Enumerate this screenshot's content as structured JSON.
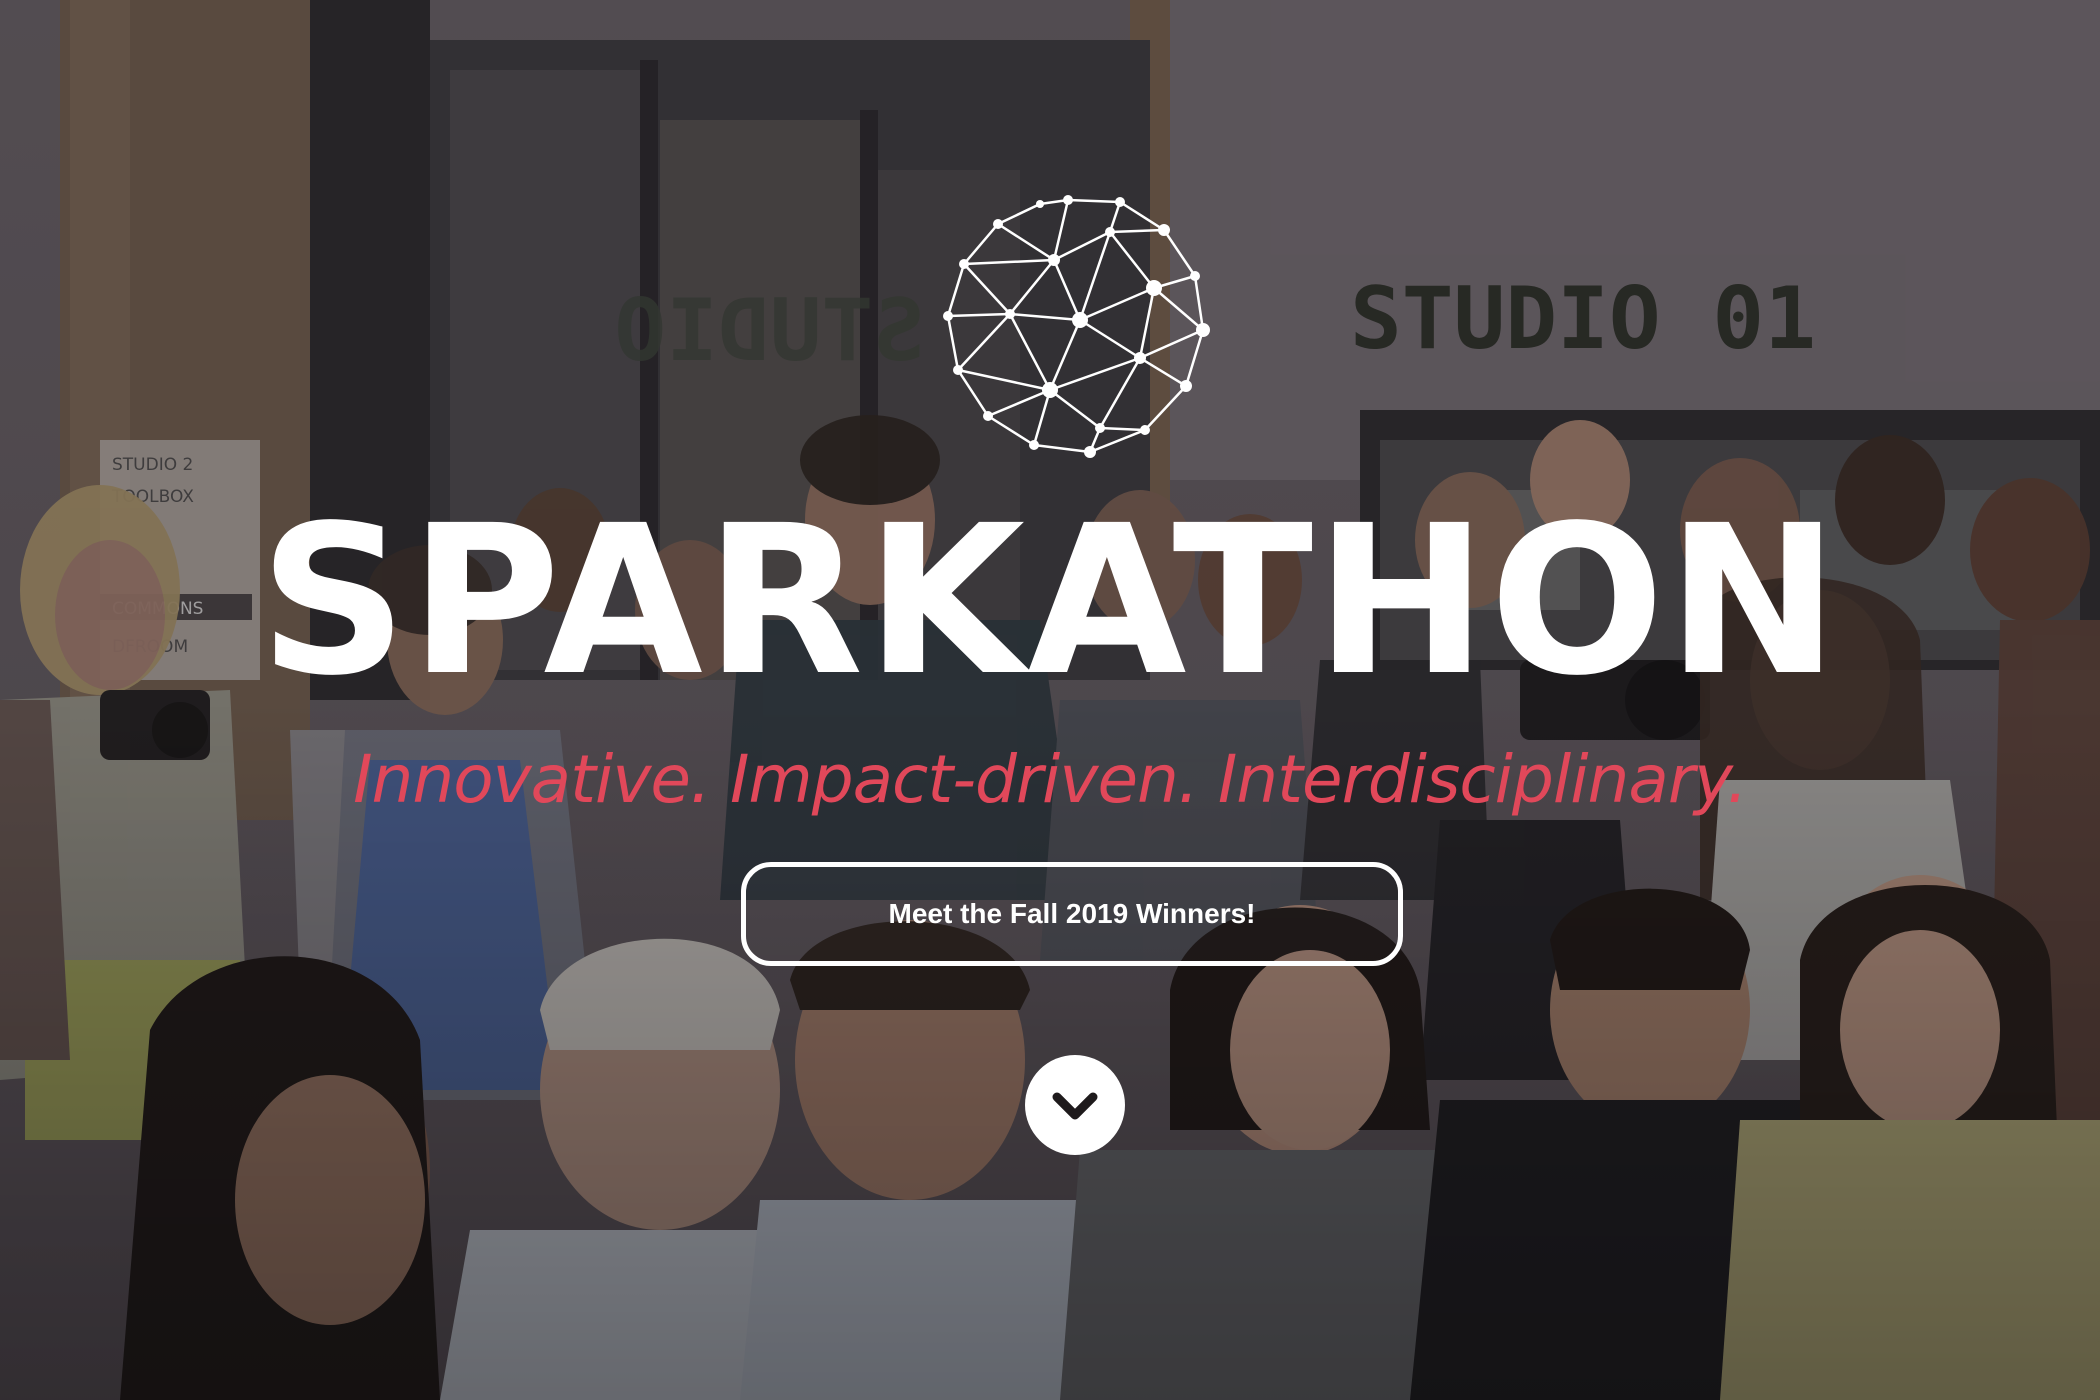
{
  "hero": {
    "brand_title": "SPARKATHON",
    "tagline": "Innovative. Impact-driven. Interdisciplinary.",
    "cta_label": "Meet the Fall 2019 Winners!",
    "logo_icon": "geodesic-sphere-icon",
    "scroll_icon": "chevron-down-icon"
  },
  "background": {
    "studio_sign": "STUDIO 01",
    "mirrored_sign": "STUDIO",
    "wayfinding": [
      "STUDIO 2",
      "TOOLBOX",
      "",
      "COMMONS",
      "DFROOM"
    ]
  },
  "colors": {
    "title": "#ffffff",
    "tagline": "#e1485a",
    "button_border": "#ffffff",
    "overlay": "#1c161c"
  }
}
